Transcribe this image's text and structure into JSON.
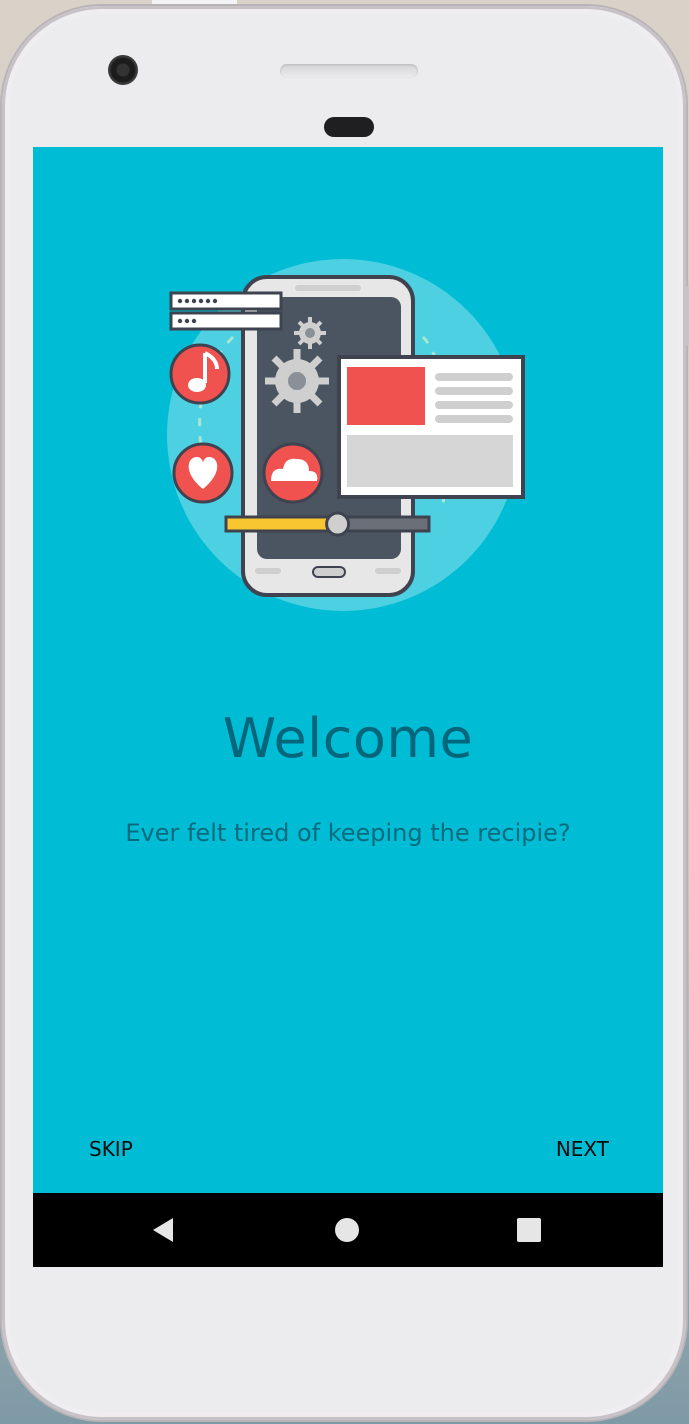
{
  "onboarding": {
    "title": "Welcome",
    "description": "Ever felt tired of keeping the recipie?",
    "skip_label": "SKIP",
    "next_label": "NEXT"
  },
  "illustration": {
    "icons": [
      "music-note-icon",
      "heart-icon",
      "cloud-icon",
      "gear-icon",
      "password-field-icon",
      "card-icon",
      "slider-icon"
    ],
    "slider_value": 0.55
  },
  "navigation_bar": {
    "icons": [
      "back-icon",
      "home-icon",
      "recent-apps-icon"
    ]
  },
  "colors": {
    "screen_background": "#00bcd4",
    "title_text": "#03667a",
    "accent_red": "#f0524f",
    "slider_fill": "#f7c630",
    "nav_background": "#000000"
  }
}
